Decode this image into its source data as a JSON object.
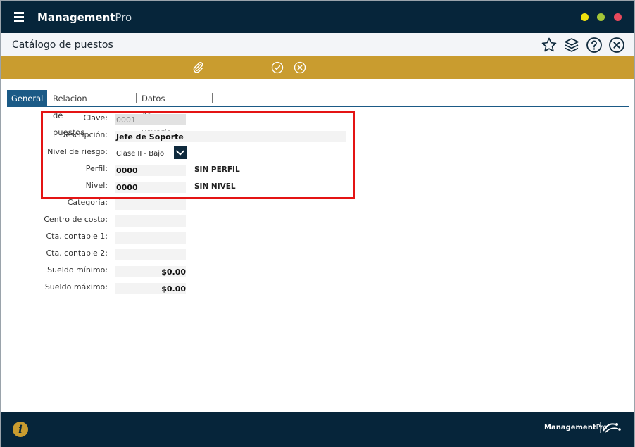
{
  "app": {
    "brand_main": "Management",
    "brand_suffix": "Pro"
  },
  "window_controls": {
    "colors": [
      "#f0e10e",
      "#a4c637",
      "#e8495c"
    ]
  },
  "header": {
    "title": "Catálogo de puestos",
    "icons": [
      "star-icon",
      "layers-icon",
      "help-icon",
      "close-circle-icon"
    ]
  },
  "toolbar": {
    "icons": [
      "paperclip-icon",
      "check-circle-icon",
      "cancel-circle-icon"
    ],
    "accent": "#c99c2f"
  },
  "tabs": [
    {
      "label": "General",
      "active": true
    },
    {
      "label": "Relacion de puestos",
      "active": false
    },
    {
      "label": "Datos de usuario",
      "active": false
    }
  ],
  "form": {
    "clave": {
      "label": "Clave:",
      "value": "0001"
    },
    "descripcion": {
      "label": "Descripción:",
      "value": "Jefe de Soporte"
    },
    "nivel_riesgo": {
      "label": "Nivel de riesgo:",
      "value": "Clase II - Bajo"
    },
    "perfil": {
      "label": "Perfil:",
      "value": "0000",
      "description": "SIN PERFIL"
    },
    "nivel": {
      "label": "Nivel:",
      "value": "0000",
      "description": "SIN NIVEL"
    },
    "categoria": {
      "label": "Categoría:",
      "value": ""
    },
    "centro_costo": {
      "label": "Centro de costo:",
      "value": ""
    },
    "cta1": {
      "label": "Cta. contable 1:",
      "value": ""
    },
    "cta2": {
      "label": "Cta. contable 2:",
      "value": ""
    },
    "sueldo_min": {
      "label": "Sueldo mínimo:",
      "value": "$0.00"
    },
    "sueldo_max": {
      "label": "Sueldo máximo:",
      "value": "$0.00"
    }
  },
  "footer": {
    "info_glyph": "i",
    "logo_main": "Management",
    "logo_suffix": "Pro"
  },
  "colors": {
    "navy": "#06253a",
    "tab_blue": "#1b5a86",
    "highlight_red": "#e41414"
  }
}
